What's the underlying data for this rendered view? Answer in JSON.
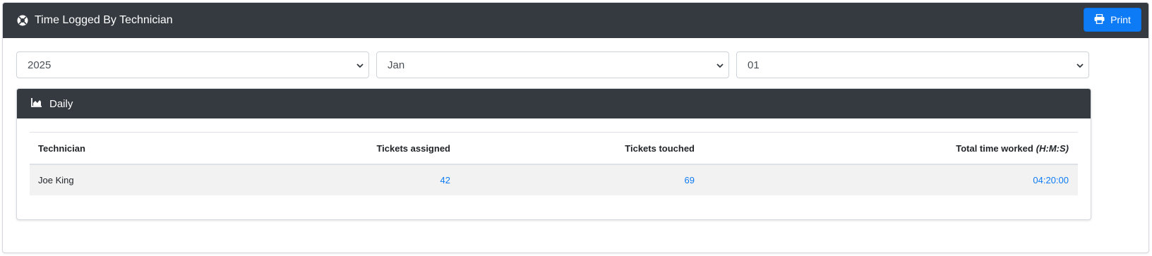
{
  "header": {
    "title": "Time Logged By Technician",
    "print_label": "Print"
  },
  "filters": {
    "year": "2025",
    "month": "Jan",
    "day": "01"
  },
  "daily": {
    "title": "Daily",
    "columns": {
      "technician": "Technician",
      "tickets_assigned": "Tickets assigned",
      "tickets_touched": "Tickets touched",
      "total_time": "Total time worked",
      "total_time_unit": "(H:M:S)"
    },
    "rows": [
      {
        "technician": "Joe King",
        "tickets_assigned": "42",
        "tickets_touched": "69",
        "total_time": "04:20:00"
      }
    ]
  },
  "colors": {
    "header_bg": "#343a40",
    "accent": "#0d7bf5",
    "row_bg": "#f2f2f2"
  },
  "icons": {
    "header": "life-ring-icon",
    "print": "printer-icon",
    "daily": "area-chart-icon",
    "select": "chevron-down-icon"
  }
}
